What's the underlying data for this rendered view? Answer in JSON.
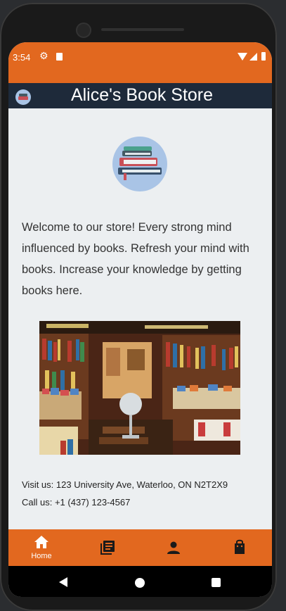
{
  "status_bar": {
    "time": "3:54"
  },
  "app_bar": {
    "title": "Alice's Book Store",
    "logo_icon": "books-logo-icon"
  },
  "welcome_text": "Welcome to our store! Every strong mind influenced by books. Refresh your mind with books. Increase your knowledge by getting books here.",
  "contact": {
    "address": "Visit us: 123 University Ave, Waterloo, ON N2T2X9",
    "phone": "Call us: +1 (437) 123-4567"
  },
  "bottom_nav": [
    {
      "label": "Home",
      "icon": "home-icon",
      "active": true
    },
    {
      "label": "",
      "icon": "library-books-icon",
      "active": false
    },
    {
      "label": "",
      "icon": "person-icon",
      "active": false
    },
    {
      "label": "",
      "icon": "shopping-bag-icon",
      "active": false
    }
  ],
  "colors": {
    "primary": "#e2681f",
    "app_bar": "#1e2a3a",
    "background": "#eceff1"
  }
}
